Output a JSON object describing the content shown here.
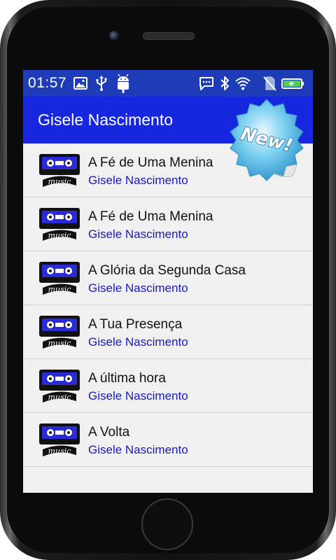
{
  "status_bar": {
    "time": "01:57",
    "icons": [
      "image-icon",
      "usb-icon",
      "android-icon",
      "chat-icon",
      "bluetooth-icon",
      "wifi-icon",
      "no-sim-icon",
      "battery-charging-icon"
    ]
  },
  "app_bar": {
    "title": "Gisele Nascimento"
  },
  "badge": {
    "text": "New!"
  },
  "songs": [
    {
      "title": "A Fé de Uma Menina",
      "artist": "Gisele Nascimento",
      "thumbnail": "music-cassette-icon"
    },
    {
      "title": "A Fé de Uma Menina",
      "artist": "Gisele Nascimento",
      "thumbnail": "music-cassette-icon"
    },
    {
      "title": "A Glória da Segunda Casa",
      "artist": "Gisele Nascimento",
      "thumbnail": "music-cassette-icon"
    },
    {
      "title": "A Tua Presença",
      "artist": "Gisele Nascimento",
      "thumbnail": "music-cassette-icon"
    },
    {
      "title": "A última hora",
      "artist": "Gisele Nascimento",
      "thumbnail": "music-cassette-icon"
    },
    {
      "title": "A Volta",
      "artist": "Gisele Nascimento",
      "thumbnail": "music-cassette-icon"
    }
  ],
  "colors": {
    "status_bar": "#1e3cb8",
    "app_bar": "#1727e0",
    "list_background": "#f0f0f0",
    "artist_text": "#1a1ab8",
    "title_text": "#111111"
  }
}
